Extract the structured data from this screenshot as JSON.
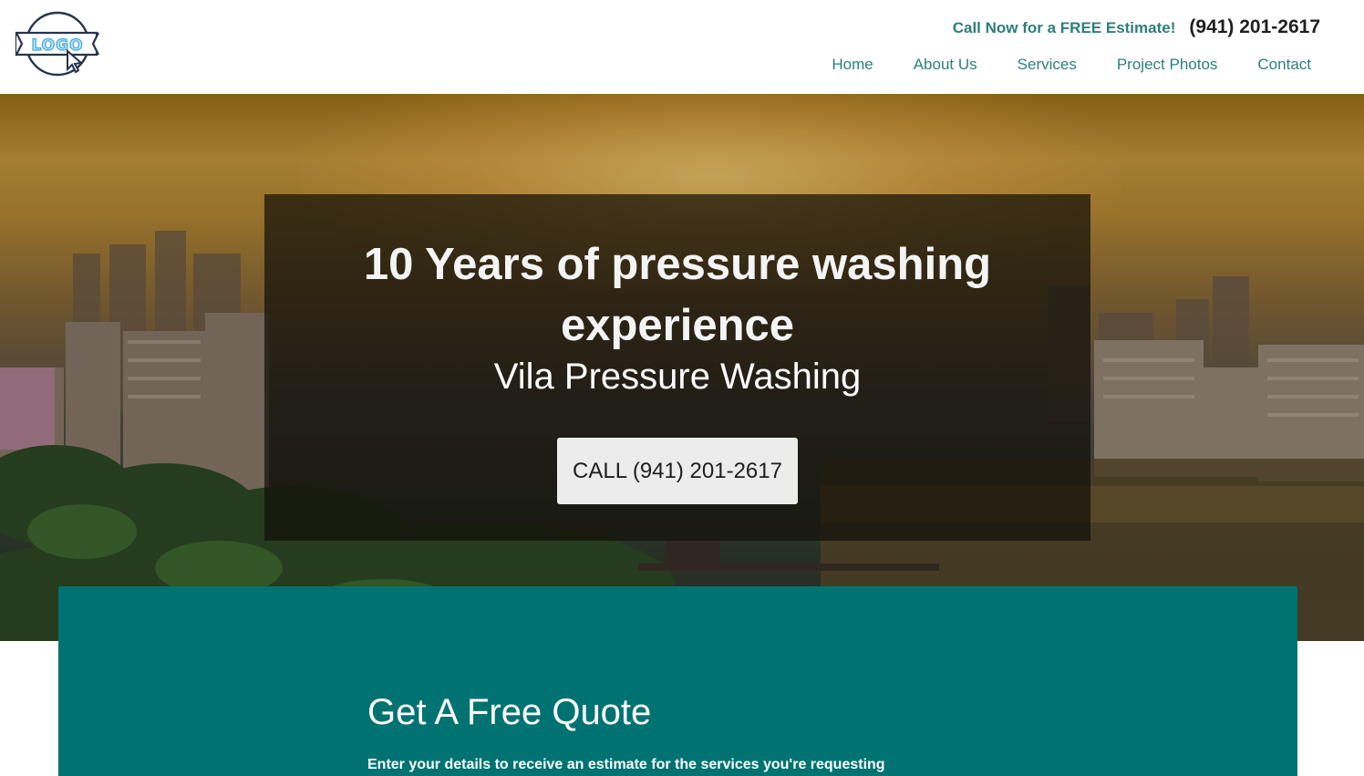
{
  "header": {
    "logo_text": "LOGO",
    "cta_text": "Call Now for a FREE Estimate!",
    "phone": "(941) 201-2617"
  },
  "nav": {
    "items": [
      "Home",
      "About Us",
      "Services",
      "Project Photos",
      "Contact"
    ]
  },
  "hero": {
    "title": "10 Years of pressure washing experience",
    "subtitle": "Vila Pressure Washing",
    "button_label": "CALL (941) 201-2617"
  },
  "quote": {
    "title": "Get A Free Quote",
    "description": "Enter your details to receive an estimate for the services you're requesting"
  },
  "colors": {
    "teal": "#017272",
    "nav_text": "#2c7f7a",
    "logo_blue": "#3aa8d8"
  }
}
